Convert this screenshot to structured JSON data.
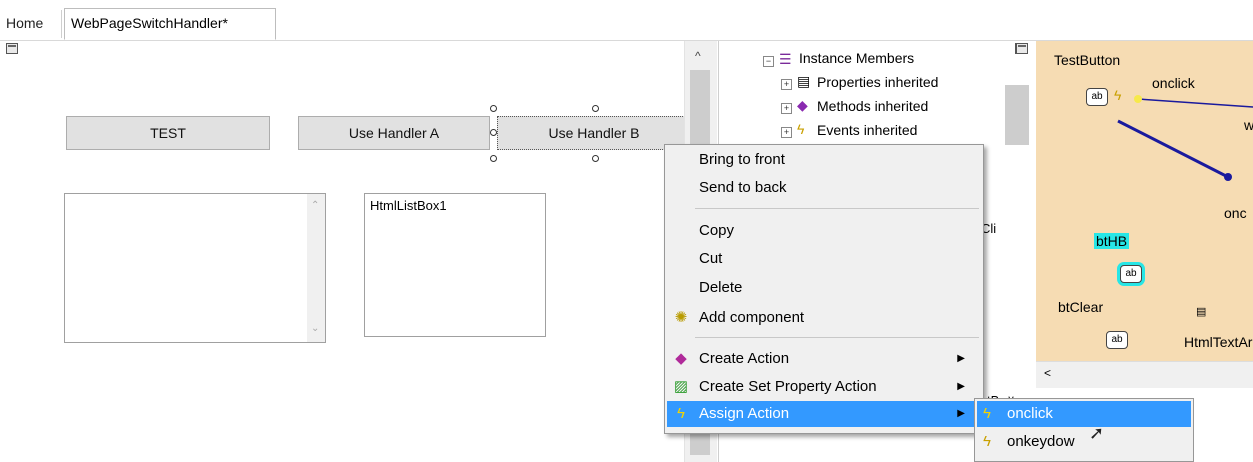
{
  "tabs": {
    "home": "Home",
    "active": "WebPageSwitchHandler*"
  },
  "designer": {
    "buttons": {
      "test": "TEST",
      "handler_a": "Use Handler A",
      "handler_b": "Use Handler B"
    },
    "listbox2_label": "HtmlListBox1"
  },
  "tree": {
    "instance_members": "Instance Members",
    "properties_inherited": "Properties inherited",
    "methods_inherited": "Methods inherited",
    "events_inherited": "Events inherited",
    "partial_cli": "Cli",
    "partial_tb": "tB"
  },
  "event_map": {
    "test_button": "TestButton",
    "onclick": "onclick",
    "partial_onc": "onc",
    "partial_w": "w",
    "bthb": "btHB",
    "btclear": "btClear",
    "htmltextarea": "HtmlTextAr"
  },
  "context_menu": {
    "bring_to_front": "Bring to front",
    "send_to_back": "Send to back",
    "copy": "Copy",
    "cut": "Cut",
    "delete": "Delete",
    "add_component": "Add component",
    "create_action": "Create Action",
    "create_set_property_action": "Create Set Property Action",
    "assign_action": "Assign Action"
  },
  "submenu": {
    "onclick": "onclick",
    "onkeydown": "onkeydow"
  },
  "colors": {
    "highlight": "#3399ff",
    "map_bg": "#f6dcb3",
    "cyan": "#27e6e6",
    "arrow_blue": "#1a1a9e"
  }
}
